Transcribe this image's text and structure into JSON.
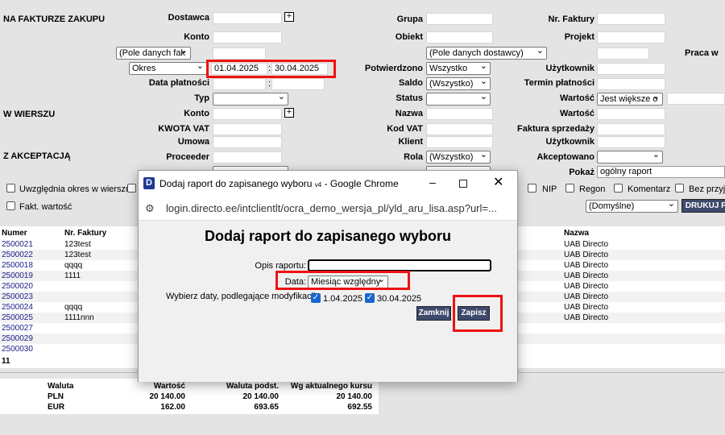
{
  "filters": {
    "section_invoice": "NA FAKTURZE ZAKUPU",
    "section_row": "W WIERSZU",
    "section_approval": "Z AKCEPTACJĄ",
    "dostawca_label": "Dostawca",
    "konto_label": "Konto",
    "pole_dostawcy_fak": "(Pole danych fak",
    "okres_select": "Okres",
    "date_from": "01.04.2025",
    "date_to": "30.04.2025",
    "date_sep": ":",
    "data_platnosci_label": "Data płatności",
    "typ_label": "Typ",
    "w_konto_label": "Konto",
    "kwota_vat_label": "KWOTA VAT",
    "umowa_label": "Umowa",
    "proceeder_label": "Proceeder",
    "grupa_label": "Grupa",
    "obiekt_label": "Obiekt",
    "pole_dostawcy": "(Pole danych dostawcy)",
    "potwierdzono_label": "Potwierdzono",
    "potwierdzono_value": "Wszystko",
    "saldo_label": "Saldo",
    "saldo_value": "(Wszystko)",
    "status_label": "Status",
    "nazwa_label": "Nazwa",
    "kod_vat_label": "Kod VAT",
    "klient_label": "Klient",
    "rola_label": "Rola",
    "rola_value": "(Wszystko)",
    "nr_faktury_label": "Nr. Faktury",
    "projekt_label": "Projekt",
    "uzytkownik_label": "Użytkownik",
    "termin_platnosci_label": "Termin płatności",
    "wartosc_label": "Wartość",
    "wartosc_value": "Jest większe o",
    "wartosc2_label": "Wartość",
    "faktura_sprzedazy_label": "Faktura sprzedaży",
    "uzytkownik2_label": "Użytkownik",
    "akceptowano_label": "Akceptowano",
    "praca_label": "Praca w",
    "pokaz_label": "Pokaż",
    "pokaz_value": "ogólny raport",
    "domyslne_value": "(Domyślne)",
    "drukuj_label": "DRUKUJ F"
  },
  "checkboxes": {
    "uwzglednia": "Uwzględnia okres w wierszu",
    "fakt_wartosc": "Fakt. wartość",
    "nip": "NIP",
    "regon": "Regon",
    "komentarz": "Komentarz",
    "bez_przyjec": "Bez przyję"
  },
  "table": {
    "col_numer": "Numer",
    "col_nr_faktury": "Nr. Faktury",
    "col_nazwa": "Nazwa",
    "rows": [
      {
        "numer": "2500021",
        "faktura": "123test",
        "nazwa": "UAB Directo"
      },
      {
        "numer": "2500022",
        "faktura": "123test",
        "nazwa": "UAB Directo"
      },
      {
        "numer": "2500018",
        "faktura": "qqqq",
        "nazwa": "UAB Directo"
      },
      {
        "numer": "2500019",
        "faktura": "1111",
        "nazwa": "UAB Directo"
      },
      {
        "numer": "2500020",
        "faktura": "",
        "nazwa": "UAB Directo"
      },
      {
        "numer": "2500023",
        "faktura": "",
        "nazwa": "UAB Directo"
      },
      {
        "numer": "2500024",
        "faktura": "qqqq",
        "nazwa": "UAB Directo"
      },
      {
        "numer": "2500025",
        "faktura": "1111nnn",
        "nazwa": "UAB Directo"
      },
      {
        "numer": "2500027",
        "faktura": "",
        "nazwa": ""
      },
      {
        "numer": "2500029",
        "faktura": "",
        "nazwa": ""
      },
      {
        "numer": "2500030",
        "faktura": "",
        "nazwa": ""
      }
    ],
    "count": "11"
  },
  "summary": {
    "headers": [
      "Waluta",
      "Wartość",
      "Waluta podst.",
      "Wg aktualnego kursu"
    ],
    "rows": [
      [
        "PLN",
        "20 140.00",
        "20 140.00",
        "20 140.00"
      ],
      [
        "EUR",
        "162.00",
        "693.65",
        "692.55"
      ]
    ]
  },
  "dialog": {
    "window_title": "Dodaj raport do zapisanego wyboru",
    "window_title_sub": "v4",
    "window_title_app": "- Google Chrome",
    "url": "login.directo.ee/intclientlt/ocra_demo_wersja_pl/yld_aru_lisa.asp?url=...",
    "heading": "Dodaj raport do zapisanego wyboru",
    "opis_label": "Opis raportu:",
    "opis_value": "",
    "data_label": "Data:",
    "data_value": "Miesiąc względny",
    "wybierz_label": "Wybierz daty, podlegające modyfikacji:",
    "date1": "1.04.2025",
    "date2": "30.04.2025",
    "zamknij": "Zamknij",
    "zapisz": "Zapisz"
  }
}
